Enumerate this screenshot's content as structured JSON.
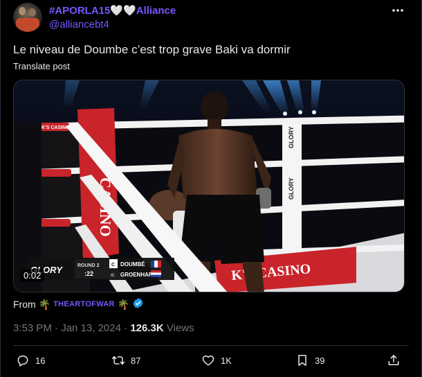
{
  "author": {
    "display_name": "#APORLA15🤍🤍Alliance",
    "handle": "@alliancebt4"
  },
  "post": {
    "text": "Le niveau de Doumbe c’est trop grave Baki va dormir",
    "translate_label": "Translate post",
    "video_time": "0:02",
    "from_label": "From",
    "source_name": "THEARTOFWAR",
    "source_emoji_left": "🌴",
    "source_emoji_right": "🌴",
    "time": "3:53 PM",
    "date": "Jan 13, 2024",
    "views_count": "126.3K",
    "views_label": "Views",
    "separator": "·"
  },
  "video_overlay": {
    "brand": "GLORY",
    "round_label": "ROUND 2",
    "round_clock": ":22",
    "fighter_1": "DOUMBÉ",
    "fighter_2": "GROENHART",
    "fighter_1_tag": "C",
    "fighter_2_tag": "IC",
    "sponsor_banner": "K'S CASINO",
    "corner_banner": "JACK'S CASINO",
    "post_sign_1": "GLORY",
    "post_sign_2": "GLORY"
  },
  "actions": {
    "replies": "16",
    "reposts": "87",
    "likes": "1K",
    "bookmarks": "39"
  },
  "colors": {
    "accent": "#7856ff",
    "verified": "#1d9bf0",
    "muted": "#71767b"
  }
}
